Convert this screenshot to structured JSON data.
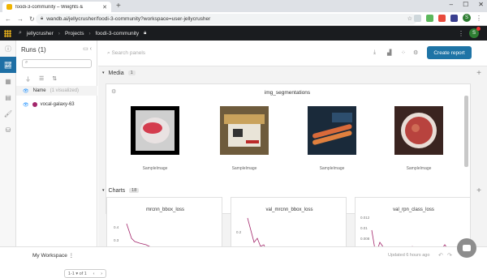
{
  "browser": {
    "tab_title": "foodi-3-community – Weights &",
    "new_tab": "+",
    "url": "wandb.ai/jellycrusher/foodi-3-community?workspace=user-jellycrusher",
    "window_controls": [
      "–",
      "☐",
      "✕"
    ],
    "profile_letter": "S"
  },
  "app": {
    "breadcrumb": [
      "jellycrusher",
      "Projects",
      "foodi-3-community"
    ],
    "avatar_letter": "S"
  },
  "runs": {
    "title": "Runs (1)",
    "column_name": "Name",
    "column_hint": "(1 visualized)",
    "items": [
      {
        "name": "vocal-galaxy-63",
        "color": "#a3266b"
      }
    ],
    "pager": "1-1 ▾ of 1"
  },
  "toolbar": {
    "search_placeholder": "Search panels",
    "create_report": "Create report"
  },
  "media": {
    "label": "Media",
    "count": "1",
    "panel_title": "img_segmentations",
    "caption": "SampleImage"
  },
  "charts": {
    "label": "Charts",
    "count": "18",
    "titles": [
      "mrcnn_bbox_loss",
      "val_mrcnn_bbox_loss",
      "val_rpn_class_loss"
    ],
    "ticks": [
      [
        "0.4",
        "0.3"
      ],
      [
        "0.2"
      ],
      [
        "0.012",
        "0.01",
        "0.008"
      ]
    ],
    "line_color": "#a3266b"
  },
  "footer": {
    "workspace": "My Workspace",
    "updated": "Updated 6 hours ago"
  }
}
